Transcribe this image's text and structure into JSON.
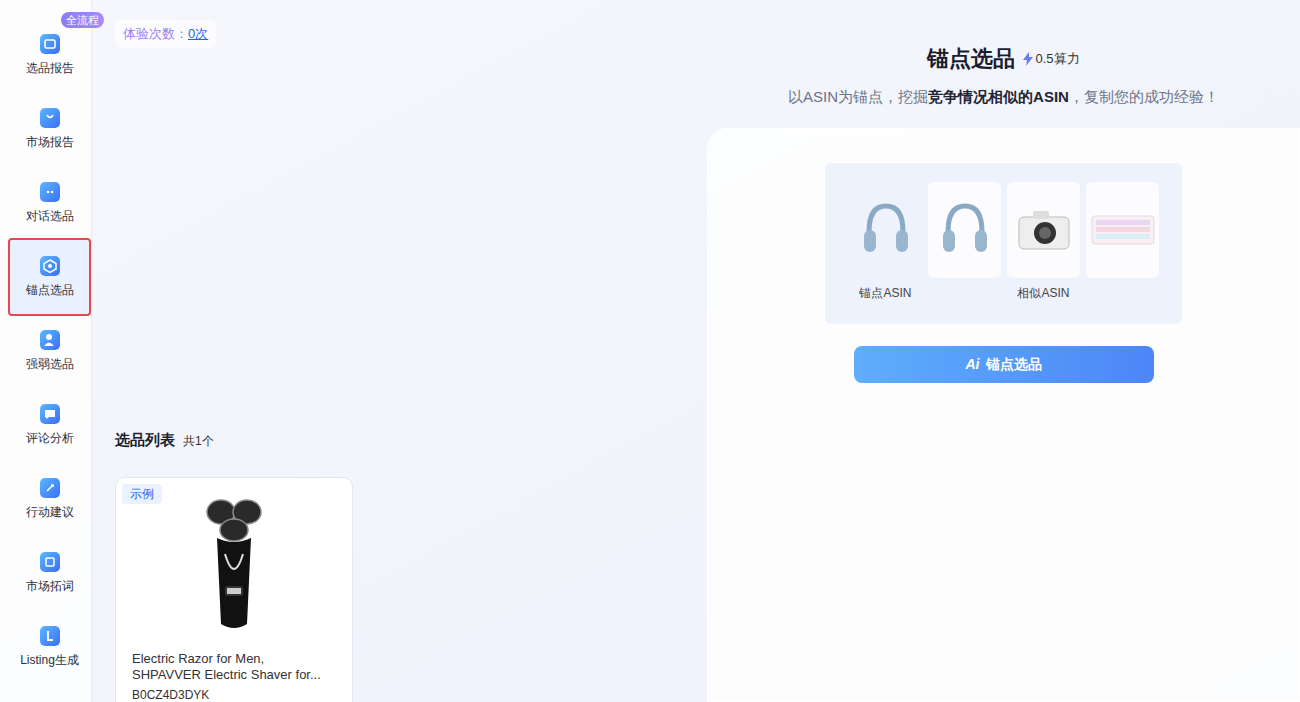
{
  "sidebar": {
    "badge": "全流程",
    "items": [
      {
        "label": "选品报告",
        "selected": false
      },
      {
        "label": "市场报告",
        "selected": false
      },
      {
        "label": "对话选品",
        "selected": false
      },
      {
        "label": "锚点选品",
        "selected": true
      },
      {
        "label": "强弱选品",
        "selected": false
      },
      {
        "label": "评论分析",
        "selected": false
      },
      {
        "label": "行动建议",
        "selected": false
      },
      {
        "label": "市场拓词",
        "selected": false
      },
      {
        "label": "Listing生成",
        "selected": false
      }
    ]
  },
  "trial": {
    "label": "体验次数：",
    "count": "0次"
  },
  "hero": {
    "title": "锚点选品",
    "cost": "0.5算力",
    "subtitle_parts": [
      {
        "text": "以ASIN为锚点，挖掘",
        "bold": false
      },
      {
        "text": "竞争情况相似的ASIN",
        "bold": true
      },
      {
        "text": "，复制您的成功经验！",
        "bold": false
      }
    ]
  },
  "illustration": {
    "anchor_label": "锚点ASIN",
    "similar_label": "相似ASIN"
  },
  "action_button": {
    "icon": "Ai",
    "label": "锚点选品"
  },
  "list": {
    "title": "选品列表",
    "count": "共1个",
    "items": [
      {
        "tag": "示例",
        "title": "Electric Razor for Men, SHPAVVER Electric Shaver for...",
        "asin": "B0CZ4D3DYK"
      }
    ]
  }
}
